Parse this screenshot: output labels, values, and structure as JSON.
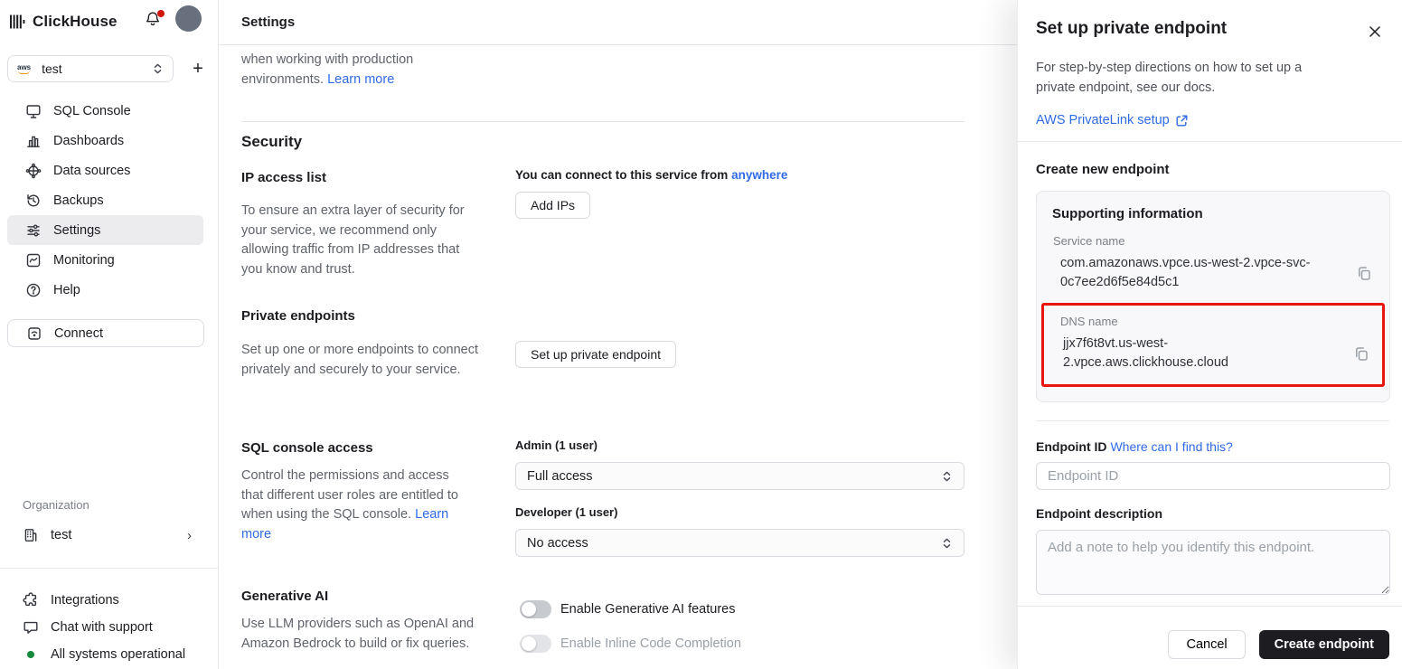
{
  "colors": {
    "accent_blue": "#2f6be6",
    "highlight_red": "#e8160c",
    "status_green": "#158a3c",
    "dark_button": "#1c1c21",
    "notification_red": "#d3140b"
  },
  "sidebar": {
    "brand": "ClickHouse",
    "service": {
      "name": "test",
      "add_button": "+"
    },
    "nav": [
      {
        "label": "SQL Console"
      },
      {
        "label": "Dashboards"
      },
      {
        "label": "Data sources"
      },
      {
        "label": "Backups"
      },
      {
        "label": "Settings"
      },
      {
        "label": "Monitoring"
      },
      {
        "label": "Help"
      }
    ],
    "connect_label": "Connect",
    "organization": {
      "label": "Organization",
      "name": "test"
    },
    "footer": {
      "integrations": "Integrations",
      "chat": "Chat with support",
      "status": "All systems operational"
    }
  },
  "main": {
    "title": "Settings",
    "intro": {
      "text": "when working with production environments. ",
      "link": "Learn more"
    },
    "security": {
      "heading": "Security",
      "ip_access": {
        "title": "IP access list",
        "description": "To ensure an extra layer of security for your service, we recommend only allowing traffic from IP addresses that you know and trust.",
        "connect_text": "You can connect to this service from ",
        "connect_link": "anywhere",
        "add_ips_button": "Add IPs"
      },
      "private_endpoints": {
        "title": "Private endpoints",
        "description": "Set up one or more endpoints to connect privately and securely to your service.",
        "button": "Set up private endpoint"
      }
    },
    "sql_console": {
      "title": "SQL console access",
      "description": "Control the permissions and access that different user roles are entitled to when using the SQL console. ",
      "link": "Learn more",
      "admin_label": "Admin (1 user)",
      "admin_value": "Full access",
      "developer_label": "Developer (1 user)",
      "developer_value": "No access"
    },
    "generative_ai": {
      "title": "Generative AI",
      "description": "Use LLM providers such as OpenAI and Amazon Bedrock to build or fix queries.",
      "toggle_generative": "Enable Generative AI features",
      "toggle_inline": "Enable Inline Code Completion"
    }
  },
  "panel": {
    "title": "Set up private endpoint",
    "description": "For step-by-step directions on how to set up a private endpoint, see our docs.",
    "docs_link": "AWS PrivateLink setup",
    "create_heading": "Create new endpoint",
    "supporting": {
      "title": "Supporting information",
      "service_name_label": "Service name",
      "service_name_value": "com.amazonaws.vpce.us-west-2.vpce-svc-0c7ee2d6f5e84d5c1",
      "dns_label": "DNS name",
      "dns_value": "jjx7f6t8vt.us-west-2.vpce.aws.clickhouse.cloud"
    },
    "endpoint_id": {
      "label": "Endpoint ID",
      "help_link": "Where can I find this?",
      "placeholder": "Endpoint ID"
    },
    "endpoint_description": {
      "label": "Endpoint description",
      "placeholder": "Add a note to help you identify this endpoint."
    },
    "cancel_button": "Cancel",
    "submit_button": "Create endpoint"
  }
}
